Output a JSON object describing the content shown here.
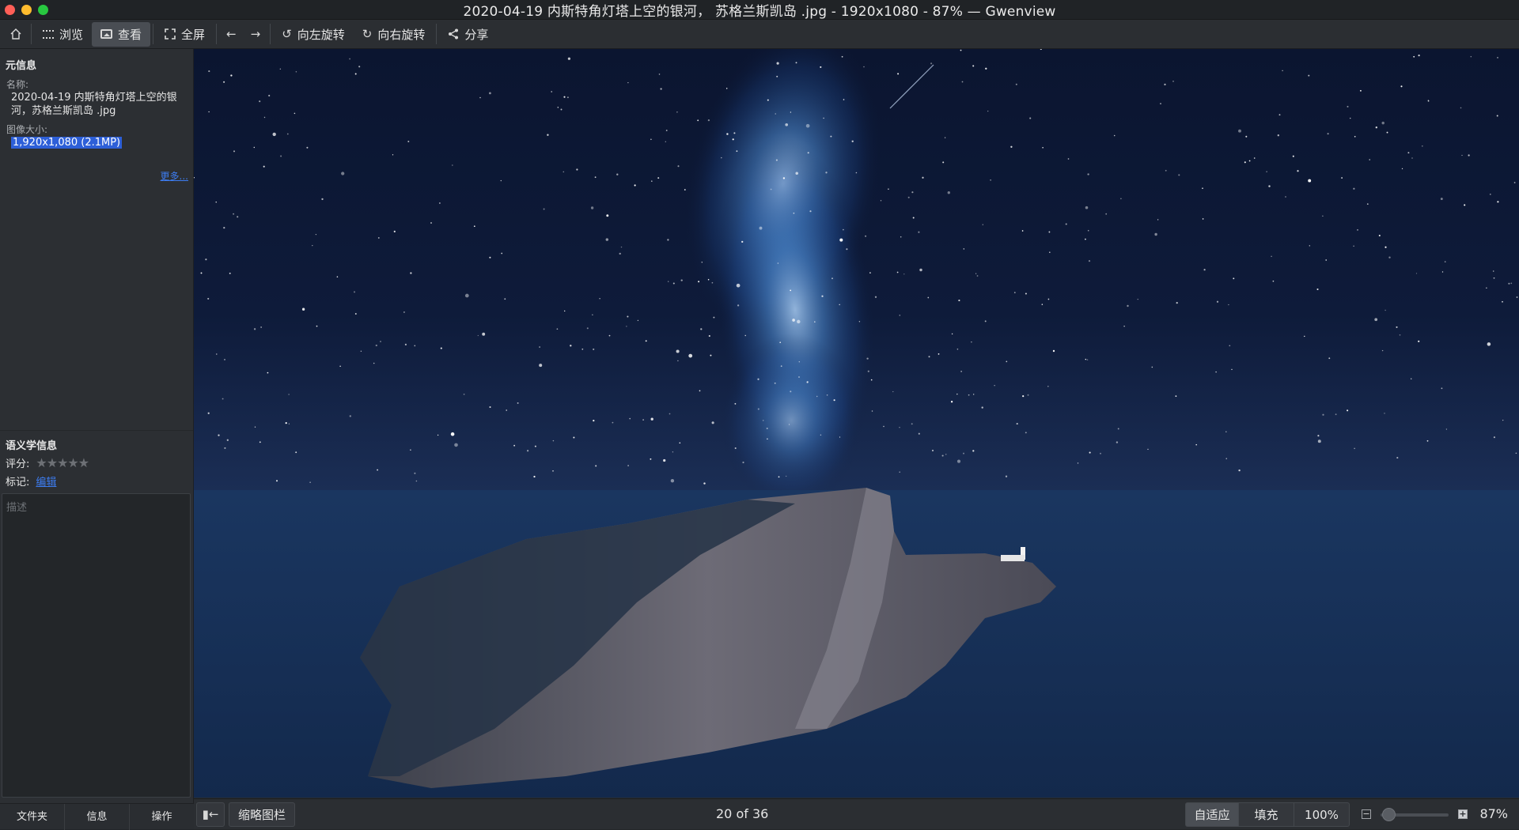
{
  "window": {
    "title": "2020-04-19 内斯特角灯塔上空的银河， 苏格兰斯凯岛 .jpg - 1920x1080 - 87% — Gwenview"
  },
  "toolbar": {
    "home_icon": "home-icon",
    "browse_label": "浏览",
    "view_label": "查看",
    "fullscreen_label": "全屏",
    "rotate_left_label": "向左旋转",
    "rotate_right_label": "向右旋转",
    "share_label": "分享"
  },
  "sidebar": {
    "meta_title": "元信息",
    "name_label": "名称:",
    "name_value": "2020-04-19 内斯特角灯塔上空的银河，苏格兰斯凯岛 .jpg",
    "size_label": "图像大小:",
    "size_value": "1,920x1,080 (2.1MP)",
    "more_link": "更多...",
    "semantic_title": "语义学信息",
    "rating_label": "评分:",
    "rating_value": 0,
    "rating_max": 5,
    "tags_label": "标记:",
    "tags_edit": "编辑",
    "description_placeholder": "描述",
    "tabs": [
      {
        "label": "文件夹"
      },
      {
        "label": "信息"
      },
      {
        "label": "操作"
      }
    ]
  },
  "statusbar": {
    "thumbbar_label": "缩略图栏",
    "position": "20 of 36",
    "fit_label": "自适应",
    "fill_label": "填充",
    "actual_label": "100%",
    "zoom_label": "87%",
    "zoom_fraction": 0.05
  },
  "colors": {
    "accent": "#2d5fd8",
    "link": "#3d7cf0",
    "sky_dark": "#0a1224",
    "sea": "#1d3b66"
  }
}
